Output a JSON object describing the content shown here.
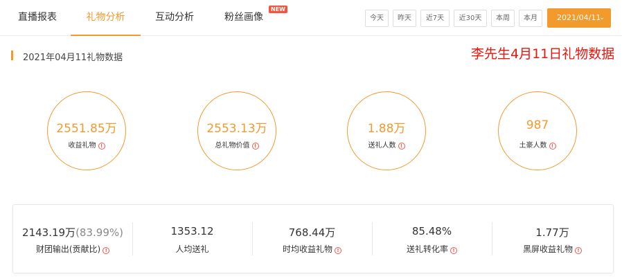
{
  "tabs": [
    {
      "label": "直播报表"
    },
    {
      "label": "礼物分析"
    },
    {
      "label": "互动分析"
    },
    {
      "label": "粉丝画像",
      "badge": "NEW"
    }
  ],
  "date_buttons": [
    "今天",
    "昨天",
    "近7天",
    "近30天",
    "本周",
    "本月"
  ],
  "date_picker": {
    "value": "2021/04/11"
  },
  "section": {
    "title": "2021年04月11礼物数据"
  },
  "note": "李先生4月11日礼物数据",
  "metrics": [
    {
      "value": "2551.85万",
      "label": "收益礼物"
    },
    {
      "value": "2553.13万",
      "label": "总礼物价值"
    },
    {
      "value": "1.88万",
      "label": "送礼人数"
    },
    {
      "value": "987",
      "label": "土豪人数"
    }
  ],
  "stats": [
    {
      "value": "2143.19万",
      "pct": "(83.99%)",
      "label": "财团输出(贡献比)",
      "warn": true
    },
    {
      "value": "1353.12",
      "label": "人均送礼",
      "warn": false
    },
    {
      "value": "768.44万",
      "label": "时均收益礼物",
      "warn": true
    },
    {
      "value": "85.48%",
      "label": "送礼转化率",
      "warn": true
    },
    {
      "value": "1.77万",
      "label": "黑屏收益礼物",
      "warn": true
    }
  ],
  "colors": {
    "accent": "#f39a2d",
    "warn": "#f0564a",
    "note": "#e8160c"
  },
  "icons": {
    "warn": "exclamation-circle-icon",
    "chevron": "chevron-down-icon"
  }
}
